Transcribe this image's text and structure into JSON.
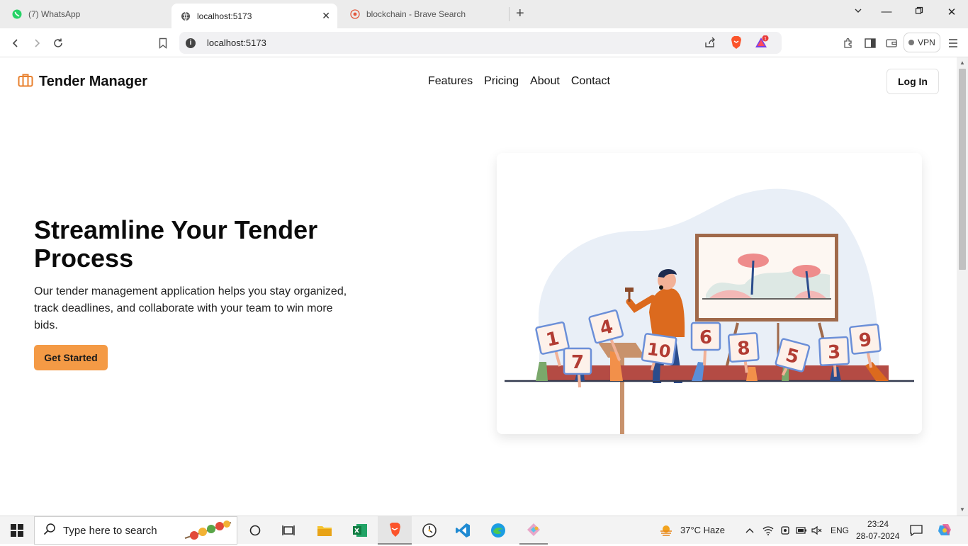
{
  "browser": {
    "tabs": [
      {
        "title": "(7) WhatsApp",
        "icon": "whatsapp-icon"
      },
      {
        "title": "localhost:5173",
        "icon": "globe-icon",
        "active": true
      },
      {
        "title": "blockchain - Brave Search",
        "icon": "brave-search-icon"
      }
    ],
    "url": "localhost:5173",
    "vpn_label": "VPN",
    "notification_count": "1"
  },
  "site": {
    "brand": "Tender Manager",
    "nav": [
      "Features",
      "Pricing",
      "About",
      "Contact"
    ],
    "login_label": "Log In",
    "hero": {
      "title": "Streamline Your Tender Process",
      "description": "Our tender management application helps you stay organized, track deadlines, and collaborate with your team to win more bids.",
      "cta_label": "Get Started"
    },
    "illustration": {
      "bid_numbers": [
        "1",
        "7",
        "4",
        "10",
        "6",
        "8",
        "5",
        "3",
        "9"
      ]
    }
  },
  "taskbar": {
    "search_placeholder": "Type here to search",
    "weather": "37°C  Haze",
    "language": "ENG",
    "time": "23:24",
    "date": "28-07-2024"
  },
  "colors": {
    "accent": "#f49a45",
    "brand_icon": "#e8802e"
  }
}
